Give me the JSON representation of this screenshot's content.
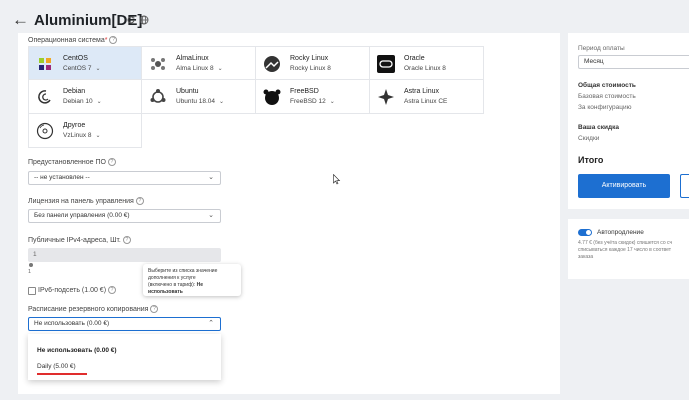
{
  "header": {
    "title": "Aluminium[DE]"
  },
  "os": {
    "label": "Операционная система",
    "items": [
      {
        "name": "CentOS",
        "version": "CentOS 7"
      },
      {
        "name": "AlmaLinux",
        "version": "Alma Linux 8"
      },
      {
        "name": "Rocky Linux",
        "version": "Rocky Linux 8"
      },
      {
        "name": "Oracle",
        "version": "Oracle Linux 8"
      },
      {
        "name": "Debian",
        "version": "Debian 10"
      },
      {
        "name": "Ubuntu",
        "version": "Ubuntu 18.04"
      },
      {
        "name": "FreeBSD",
        "version": "FreeBSD 12"
      },
      {
        "name": "Astra Linux",
        "version": "Astra Linux CE"
      },
      {
        "name": "Другое",
        "version": "VzLinux 8"
      }
    ]
  },
  "software": {
    "label": "Предустановленное ПО",
    "value": "-- не установлен --"
  },
  "license": {
    "label": "Лицензия на панель управления",
    "value": "Без панели управления (0.00 €)"
  },
  "ipv4": {
    "label": "Публичные IPv4-адреса, Шт.",
    "value": "1",
    "slider_min": "1"
  },
  "ipv6": {
    "label": "IPv6-подсеть (1.00 €)"
  },
  "tooltip": {
    "line1": "Выберите из списка значение",
    "line2": "дополнения к услуге",
    "line3": "(включено в тариф):",
    "bold": "Не использовать"
  },
  "backup": {
    "label": "Расписание резервного копирования",
    "value": "Не использовать (0.00 €)",
    "options": [
      "Не использовать (0.00 €)",
      "Daily (5.00 €)"
    ]
  },
  "sidebar": {
    "period_label": "Период оплаты",
    "period_value": "Месяц",
    "total_label": "Общая стоимость",
    "base_cost": "Базовая стоимость",
    "config_cost": "За конфигурацию",
    "discount_label": "Ваша скидка",
    "discount_value": "Скидки",
    "total_title": "Итого",
    "activate": "Активировать",
    "autorenew_label": "Автопродление",
    "autorenew_desc1": "4.77 € (без учёта скидок) спишется со сч",
    "autorenew_desc2": "списываться каждое 17 число в соответ",
    "autorenew_desc3": "заказа"
  },
  "colors": {
    "accent": "#1d6fd1",
    "selected_bg": "#dde9f7",
    "underline": "#e02d2d"
  }
}
